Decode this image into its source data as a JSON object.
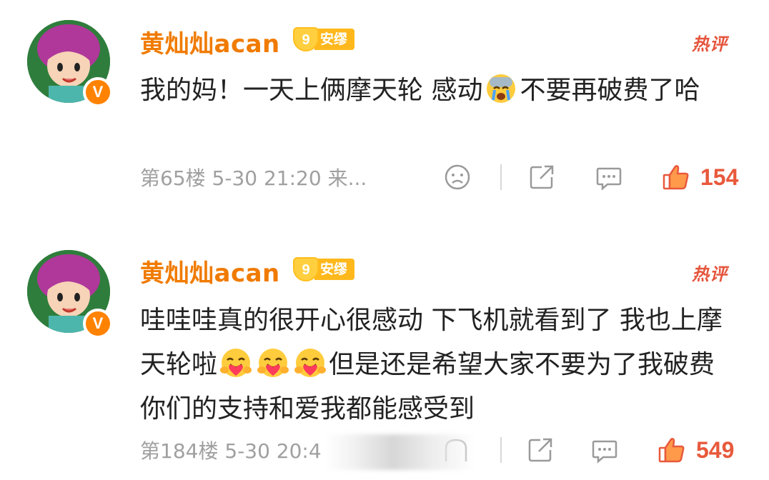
{
  "comments": [
    {
      "username": "黄灿灿acan",
      "fan_level": "9",
      "fan_badge": "安缪",
      "hot_label": "热评",
      "text_part1": "我的妈！一天上俩摩天轮 感动",
      "emoji1": "crying-face",
      "text_part2": "不要再破费了哈",
      "meta": "第65楼 5-30 21:20 来...",
      "likes": "154",
      "verified": "V"
    },
    {
      "username": "黄灿灿acan",
      "fan_level": "9",
      "fan_badge": "安缪",
      "hot_label": "热评",
      "text_part1": "哇哇哇真的很开心很感动 下飞机就看到了 我也上摩天轮啦",
      "emoji": "hugging-face",
      "text_part2": "但是还是希望大家不要为了我破费 你们的支持和爱我都能感受到",
      "meta": "第184楼 5-30 20:4",
      "likes": "549",
      "verified": "V"
    }
  ],
  "colors": {
    "username": "#f07b00",
    "hot": "#e5553c",
    "likes": "#e8593c",
    "meta": "#a0a0a0",
    "vbadge": "#ff8200"
  },
  "icons": [
    "sad-face-icon",
    "share-icon",
    "comment-icon",
    "thumbs-up-icon"
  ]
}
